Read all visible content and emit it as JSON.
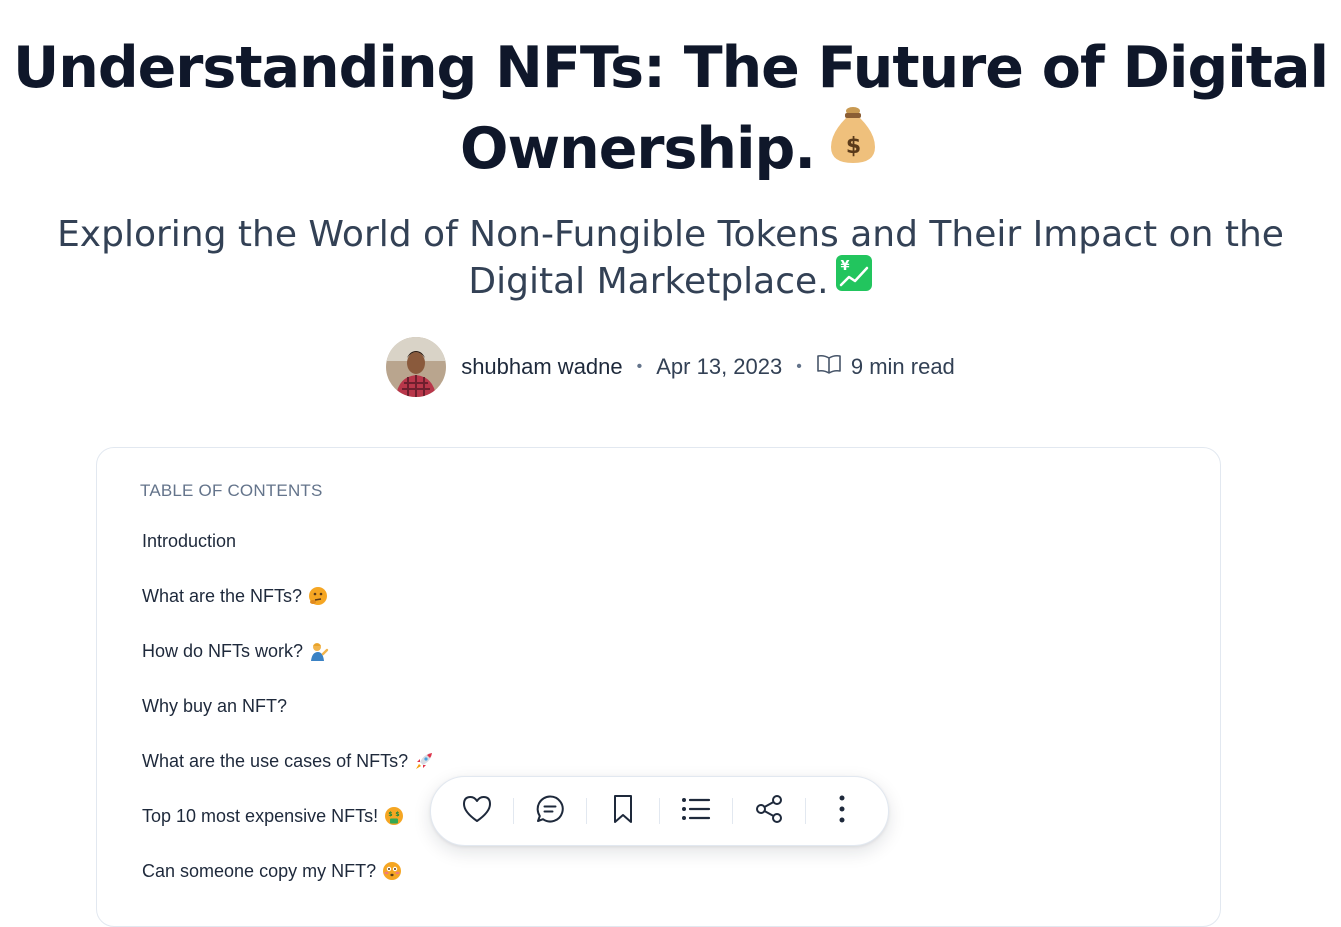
{
  "article": {
    "title": "Understanding NFTs: The Future of Digital Ownership.",
    "title_emoji_icon": "money-bag-icon",
    "subtitle": "Exploring the World of Non-Fungible Tokens and Their Impact on the Digital Marketplace.",
    "subtitle_emoji_icon": "chart-increasing-yen-icon",
    "author": "shubham wadne",
    "date": "Apr 13, 2023",
    "read_time": "9 min read",
    "read_icon": "open-book-icon"
  },
  "toc": {
    "heading": "TABLE OF CONTENTS",
    "items": [
      {
        "label": "Introduction",
        "emoji": ""
      },
      {
        "label": "What are the NFTs?",
        "emoji": "thinking-face-icon"
      },
      {
        "label": "How do NFTs work?",
        "emoji": "person-tipping-hand-icon"
      },
      {
        "label": "Why buy an NFT?",
        "emoji": ""
      },
      {
        "label": "What are the use cases of NFTs?",
        "emoji": "rocket-icon"
      },
      {
        "label": "Top 10 most expensive NFTs!",
        "emoji": "money-mouth-face-icon"
      },
      {
        "label": "Can someone copy my NFT?",
        "emoji": "flushed-face-icon"
      }
    ]
  },
  "toolbar": {
    "buttons": [
      "like-icon",
      "comment-icon",
      "bookmark-icon",
      "table-of-contents-icon",
      "share-icon",
      "more-options-icon"
    ]
  },
  "colors": {
    "title": "#0f172a",
    "subtitle": "#334155",
    "muted": "#64748b",
    "border": "#e2e8f0",
    "emoji_gold": "#e8b469",
    "emoji_green": "#22c55e"
  }
}
